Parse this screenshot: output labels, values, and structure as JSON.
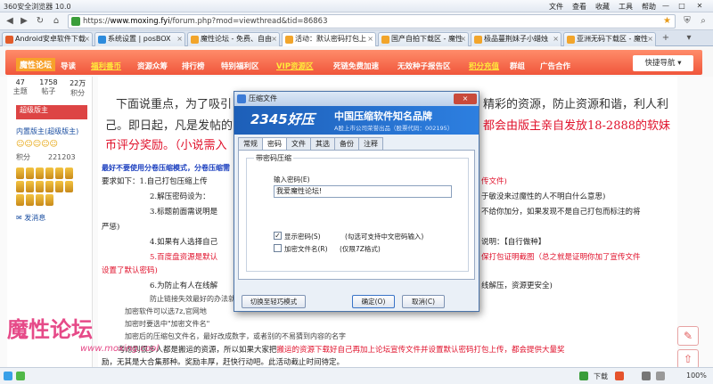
{
  "browser": {
    "app_title": "360安全浏览器 10.0",
    "menus": [
      "文件",
      "查看",
      "收藏",
      "工具",
      "帮助"
    ],
    "url_prefix": "https://",
    "url_domain": "www.moxing.fyi",
    "url_path": "/forum.php?mod=viewthread&tid=86863"
  },
  "tabs": [
    {
      "label": "Android安卓软件下载"
    },
    {
      "label": "系统设置 | posBOX"
    },
    {
      "label": "魔性论坛 - 免费、自由"
    },
    {
      "label": "活动：默认密码打包上"
    },
    {
      "label": "国产自拍下载区 - 魔性"
    },
    {
      "label": "极品蔓荆妹子小蜡烛"
    },
    {
      "label": "亚洲无码下载区 - 魔性"
    }
  ],
  "site_nav": {
    "logo": "魔性论坛",
    "items": [
      "导读",
      "福利番币",
      "资源众筹",
      "排行榜",
      "特别福利区",
      "VIP资源区",
      "死链免费加速",
      "无效种子报告区",
      "积分充值",
      "群组",
      "广告合作"
    ],
    "quick_nav": "快捷导航"
  },
  "user": {
    "stats": [
      {
        "value": "47",
        "label": "主题"
      },
      {
        "value": "1758",
        "label": "帖子"
      },
      {
        "value": "22万",
        "label": "积分"
      }
    ],
    "title_badge": "超级版主",
    "group": "内置版主(超级版主)",
    "smileys": "☺☺☺☺☺",
    "points_label": "积分",
    "points_value": "221203",
    "pm": "发消息"
  },
  "post": {
    "p1_a": "下面说重点，为了吸引",
    "p1_b": "精彩的资源，防止资源和谐，利人利",
    "p2_a": "己。即日起，凡是发帖的",
    "p2_b": "都会由版主亲自发放18-2888的软妹",
    "p3": "币评分奖励。（小说需入",
    "bold_note": "最好不要使用分卷压缩模式，分卷压缩需",
    "req_intro": "要求如下：1.自己打包压缩上传",
    "req_intro_tail": "传文件)",
    "req2": "2.解压密码设为：",
    "req2_tail": "于敏没来过魔性的人不明白什么意思)",
    "req3": "3.标题前面需说明是",
    "req3_tail": "不给你加分，如果发现不是自己打包而标注的将",
    "req3_end": "严惩)",
    "req4": "4.如果有人选择自己",
    "req4_tail": "说明：【自行做种】",
    "req5": "5.百度盘资源是默认",
    "req5_tail": "保打包证明截图（总之就是证明你加了宣传文件",
    "req5_end": "设置了默认密码)",
    "req6": "6.为防止有人在线解",
    "req6_tail": "线解压，资源更安全)",
    "tip1": "防止链接失效最好的办法就",
    "tip2": "加密软件可以选7z,官网地",
    "tip3": "加密时要选中\"加密文件名\"",
    "tip4": "加密后的压缩包文件名，最好改成数字，或者别的不易猜到内容的名字",
    "footer_a": "考虑到很多人都是搬运的资源，所以如果大家把",
    "footer_b": "搬运的资源下载好自己再加上论坛宣传文件并设置默认密码打包上传，都会提供大量奖",
    "footer_c": "励，无其是大合集那种。奖励丰厚，赶快行动吧。此活动截止时间待定。"
  },
  "watermark": {
    "text": "魔性论坛",
    "url": "www.moxing.cool"
  },
  "dialog": {
    "title": "压缩文件",
    "close": "×",
    "brand": "2345好压",
    "slogan": "中国压缩软件知名品牌",
    "sub": "A股上市公司荣誉出品（股票代码：002195）",
    "tabs": [
      "常规",
      "密码",
      "文件",
      "其选",
      "备份",
      "注释"
    ],
    "active_tab": 1,
    "group_label": "带密码压缩",
    "password_label": "输入密码(E)",
    "password_value": "我爱魔性论坛!",
    "show_password": "显示密码(S)",
    "show_password_hint": "(勾选可支持中文密码输入)",
    "encrypt_names": "加密文件名(R)",
    "encrypt_names_hint": "(仅限7Z格式)",
    "btn_easy": "切换至轻巧模式",
    "btn_ok": "确定(O)",
    "btn_cancel": "取消(C)"
  },
  "statusbar": {
    "download": "下载",
    "zoom": "100%"
  }
}
